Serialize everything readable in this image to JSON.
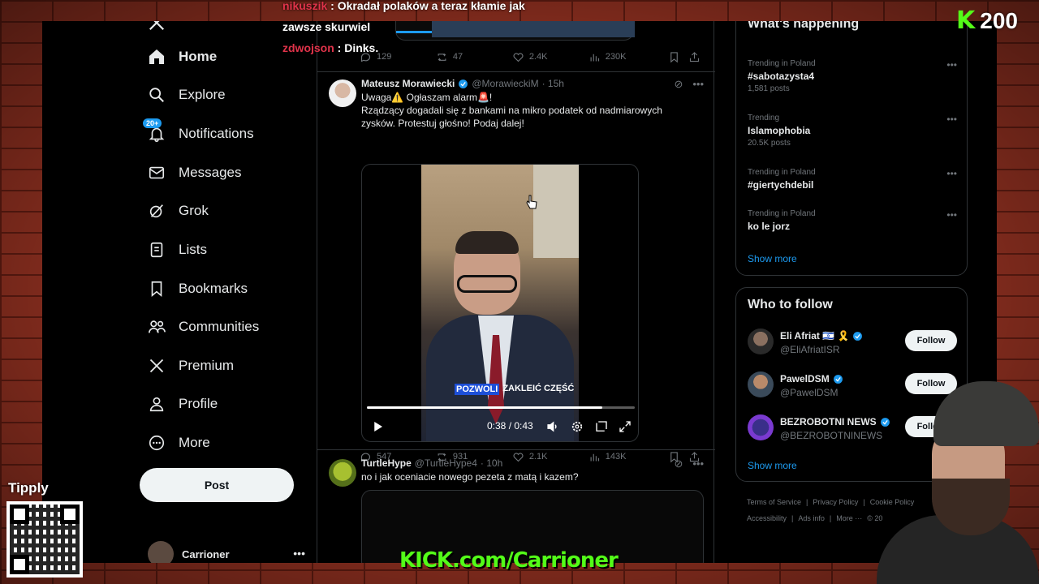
{
  "chat": {
    "line1_user": "nikuszik",
    "line1_text": ": Okradał polaków a teraz kłamie jak",
    "line2_text": "zawsze skurwiel",
    "line3_user": "zdwojson",
    "line3_text": ": Dinks."
  },
  "kick": {
    "logo": "K",
    "viewers": "200",
    "url": "KICK.com/Carrioner"
  },
  "tipply": {
    "label": "Tipply"
  },
  "nav": {
    "items": [
      {
        "label": "Home",
        "icon": "home-icon"
      },
      {
        "label": "Explore",
        "icon": "search-icon"
      },
      {
        "label": "Notifications",
        "icon": "bell-icon",
        "badge": "20+"
      },
      {
        "label": "Messages",
        "icon": "envelope-icon"
      },
      {
        "label": "Grok",
        "icon": "grok-icon"
      },
      {
        "label": "Lists",
        "icon": "list-icon"
      },
      {
        "label": "Bookmarks",
        "icon": "bookmark-icon"
      },
      {
        "label": "Communities",
        "icon": "people-icon"
      },
      {
        "label": "Premium",
        "icon": "x-logo-icon"
      },
      {
        "label": "Profile",
        "icon": "person-icon"
      },
      {
        "label": "More",
        "icon": "more-circle-icon"
      }
    ],
    "post_label": "Post",
    "account_name": "Carrioner"
  },
  "feed": {
    "top_actions": {
      "replies": "129",
      "reposts": "47",
      "likes": "2.4K",
      "views": "230K"
    },
    "tweet1": {
      "name": "Mateusz Morawiecki",
      "handle": "@MorawieckiM",
      "time": "· 15h",
      "line1": "Uwaga⚠️ Ogłaszam alarm🚨!",
      "line2": "Rządzący dogadali się z bankami na mikro podatek od nadmiarowych zysków. Protestuj głośno! Podaj dalej!",
      "caption_hl": "POZWOLI",
      "caption_rest": "ZAKLEIĆ CZĘŚĆ",
      "video_time": "0:38 / 0:43",
      "progress": 0.88,
      "actions": {
        "replies": "547",
        "reposts": "931",
        "likes": "2.1K",
        "views": "143K"
      }
    },
    "tweet2": {
      "name": "TurtleHype",
      "handle": "@TurtleHype4",
      "time": "· 10h",
      "text": "no i jak oceniacie nowego pezeta z matą i kazem?"
    }
  },
  "right": {
    "happening_title": "What's happening",
    "trends": [
      {
        "context": "Trending in Poland",
        "title": "#sabotazysta4",
        "count": "1,581 posts"
      },
      {
        "context": "Trending",
        "title": "Islamophobia",
        "count": "20.5K posts"
      },
      {
        "context": "Trending in Poland",
        "title": "#giertychdebil",
        "count": ""
      },
      {
        "context": "Trending in Poland",
        "title": "ko le jorz",
        "count": ""
      }
    ],
    "show_more": "Show more",
    "wtf_title": "Who to follow",
    "follow_suggestions": [
      {
        "name": "Eli Afriat 🇮🇱 🎗️",
        "handle": "@EliAfriatISR",
        "button": "Follow"
      },
      {
        "name": "PawelDSM",
        "handle": "@PawelDSM",
        "button": "Follow"
      },
      {
        "name": "BEZROBOTNI NEWS",
        "handle": "@BEZROBOTNINEWS",
        "button": "Follow"
      }
    ],
    "footer": [
      "Terms of Service",
      "|",
      "Privacy Policy",
      "|",
      "Cookie Policy",
      "Accessibility",
      "|",
      "Ads info",
      "|",
      "More ···",
      "© 20"
    ]
  },
  "colors": {
    "accent": "#1d9bf0",
    "background": "#000000",
    "kick_green": "#53fc18",
    "text": "#e7e9ea",
    "muted": "#71767b"
  }
}
